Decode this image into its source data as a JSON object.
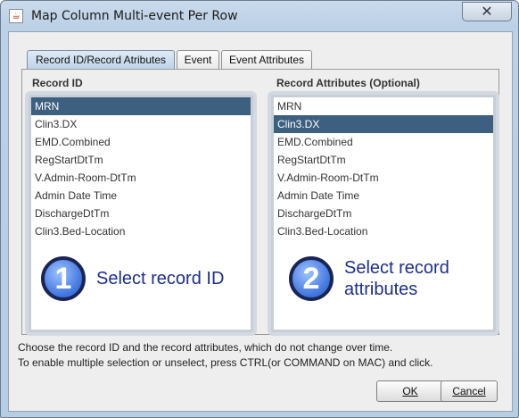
{
  "window": {
    "title": "Map Column Multi-event Per Row",
    "close_glyph": "✕"
  },
  "tabs": [
    {
      "label": "Record ID/Record Atributes",
      "active": true
    },
    {
      "label": "Event",
      "active": false
    },
    {
      "label": "Event Attributes",
      "active": false
    }
  ],
  "record_id": {
    "label": "Record ID",
    "items": [
      "MRN",
      "Clin3.DX",
      "EMD.Combined",
      "RegStartDtTm",
      "V.Admin-Room-DtTm",
      "Admin Date Time",
      "DischargeDtTm",
      "Clin3.Bed-Location"
    ],
    "selected_index": 0,
    "step_number": "1",
    "step_text": "Select record ID"
  },
  "record_attributes": {
    "label": "Record Attributes (Optional)",
    "items": [
      "MRN",
      "Clin3.DX",
      "EMD.Combined",
      "RegStartDtTm",
      "V.Admin-Room-DtTm",
      "Admin Date Time",
      "DischargeDtTm",
      "Clin3.Bed-Location"
    ],
    "selected_index": 1,
    "step_number": "2",
    "step_text": "Select record attributes"
  },
  "hints": [
    "Choose the record ID and the record attributes, which do not change over time.",
    "To enable multiple selection or unselect, press CTRL(or COMMAND on MAC) and click."
  ],
  "buttons": {
    "ok_label": "OK",
    "cancel_label": "Cancel"
  },
  "colors": {
    "selection": "#3d5f80",
    "step_text": "#1c2f8a",
    "step_circle": "#3f74de"
  },
  "icons": {
    "app": "java-cup-icon",
    "close": "close-icon"
  }
}
